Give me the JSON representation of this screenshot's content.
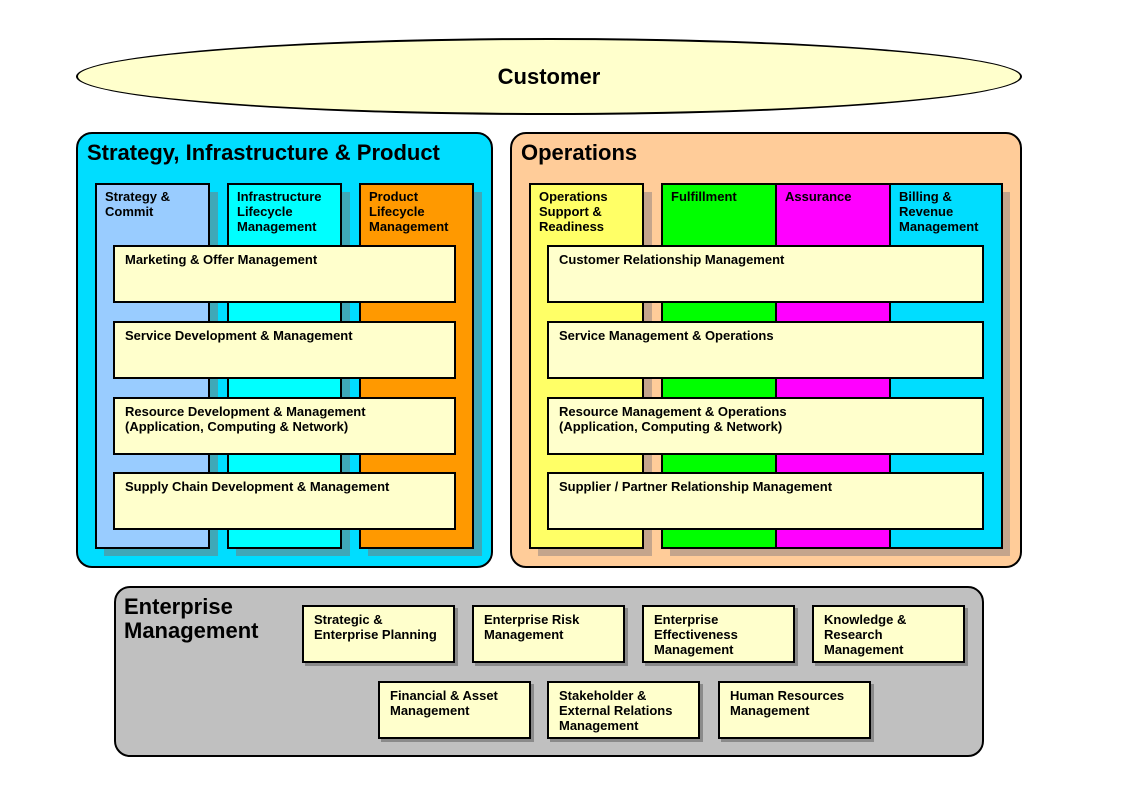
{
  "customer": {
    "label": "Customer",
    "fill": "#ffffcc"
  },
  "strategy_infrastructure_product": {
    "title": "Strategy, Infrastructure & Product",
    "fill": "#00ddff",
    "columns": [
      {
        "label": "Strategy &\nCommit",
        "fill": "#99ccff"
      },
      {
        "label": "Infrastructure\nLifecycle\nManagement",
        "fill": "#00ffff"
      },
      {
        "label": "Product\nLifecycle\nManagement",
        "fill": "#ff9900"
      }
    ],
    "bars": [
      {
        "label": "Marketing & Offer Management"
      },
      {
        "label": "Service Development & Management"
      },
      {
        "label": "Resource Development & Management\n(Application, Computing & Network)"
      },
      {
        "label": "Supply Chain Development & Management"
      }
    ]
  },
  "operations": {
    "title": "Operations",
    "fill": "#ffcc99",
    "columns": [
      {
        "label": "Operations\nSupport &\nReadiness",
        "fill": "#ffff66"
      },
      {
        "label": "Fulfillment",
        "fill": "#00ff00"
      },
      {
        "label": "Assurance",
        "fill": "#ff00ff"
      },
      {
        "label": "Billing &\nRevenue\nManagement",
        "fill": "#00ddff"
      }
    ],
    "bars": [
      {
        "label": "Customer Relationship Management"
      },
      {
        "label": "Service Management & Operations"
      },
      {
        "label": "Resource Management & Operations\n(Application, Computing & Network)"
      },
      {
        "label": "Supplier / Partner Relationship Management"
      }
    ]
  },
  "enterprise_management": {
    "title": "Enterprise\nManagement",
    "fill": "#c0c0c0",
    "boxes": [
      {
        "label": "Strategic &\nEnterprise Planning"
      },
      {
        "label": "Enterprise Risk\nManagement"
      },
      {
        "label": "Enterprise\nEffectiveness\nManagement"
      },
      {
        "label": "Knowledge &\nResearch\nManagement"
      },
      {
        "label": "Financial & Asset\nManagement"
      },
      {
        "label": "Stakeholder &\nExternal Relations\nManagement"
      },
      {
        "label": "Human Resources\nManagement"
      }
    ]
  }
}
